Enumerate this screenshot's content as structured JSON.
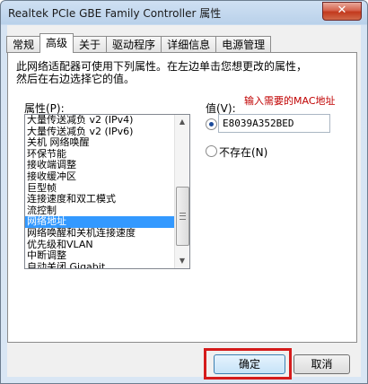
{
  "window": {
    "title": "Realtek PCIe GBE Family Controller 属性",
    "close_glyph": "✕"
  },
  "tabs": [
    {
      "label": "常规",
      "active": false
    },
    {
      "label": "高级",
      "active": true
    },
    {
      "label": "关于",
      "active": false
    },
    {
      "label": "驱动程序",
      "active": false
    },
    {
      "label": "详细信息",
      "active": false
    },
    {
      "label": "电源管理",
      "active": false
    }
  ],
  "advanced": {
    "description_line1": "此网络适配器可使用下列属性。在左边单击您想更改的属性，",
    "description_line2": "然后在右边选择它的值。",
    "property_label": "属性(P):",
    "value_label": "值(V):",
    "properties": [
      "大量传送减负 v2 (IPv4)",
      "大量传送减负 v2 (IPv6)",
      "关机 网络唤醒",
      "环保节能",
      "接收端调整",
      "接收缓冲区",
      "巨型帧",
      "连接速度和双工模式",
      "流控制",
      "网络地址",
      "网络唤醒和关机连接速度",
      "优先级和VLAN",
      "中断调整",
      "自动关闭 Gigabit"
    ],
    "selected_index": 9,
    "value_input": "E8039A352BED",
    "not_present_label": "不存在(N)",
    "value_option_selected": "value"
  },
  "annotation": {
    "text": "输入需要的MAC地址",
    "color": "#c00000"
  },
  "buttons": {
    "ok": "确定",
    "cancel": "取消"
  },
  "scrollbar": {
    "up_glyph": "▲",
    "down_glyph": "▼"
  }
}
